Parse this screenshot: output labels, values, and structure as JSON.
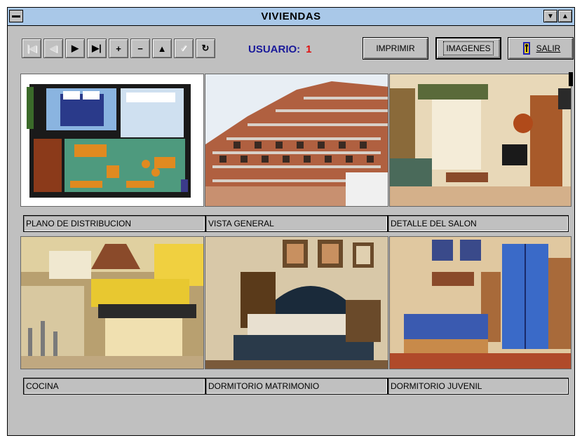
{
  "window": {
    "title": "VIVIENDAS"
  },
  "toolbar": {
    "nav_buttons": [
      {
        "icon": "first-record-icon",
        "glyph": "⏮",
        "enabled": false
      },
      {
        "icon": "previous-record-icon",
        "glyph": "◀",
        "enabled": false
      },
      {
        "icon": "next-record-icon",
        "glyph": "▶",
        "enabled": true
      },
      {
        "icon": "last-record-icon",
        "glyph": "⏭",
        "enabled": true
      },
      {
        "icon": "add-record-icon",
        "glyph": "+",
        "enabled": true
      },
      {
        "icon": "delete-record-icon",
        "glyph": "−",
        "enabled": true
      },
      {
        "icon": "edit-record-icon",
        "glyph": "▲",
        "enabled": true
      },
      {
        "icon": "save-record-icon",
        "glyph": "✓",
        "enabled": false
      },
      {
        "icon": "refresh-icon",
        "glyph": "↻",
        "enabled": true
      }
    ],
    "user_label": "USUARIO:",
    "user_value": "1",
    "print_label": "IMPRIMIR",
    "images_label": "IMAGENES",
    "exit_label": "SALIR"
  },
  "gallery": {
    "items": [
      {
        "caption": "PLANO DE DISTRIBUCION"
      },
      {
        "caption": "VISTA GENERAL"
      },
      {
        "caption": "DETALLE DEL SALON"
      },
      {
        "caption": "COCINA"
      },
      {
        "caption": "DORMITORIO MATRIMONIO"
      },
      {
        "caption": "DORMITORIO JUVENIL"
      }
    ]
  },
  "colors": {
    "titlebar": "#a9c8e8",
    "window": "#c0c0c0",
    "user_label": "#1a1a9a",
    "user_value": "#e01010"
  }
}
